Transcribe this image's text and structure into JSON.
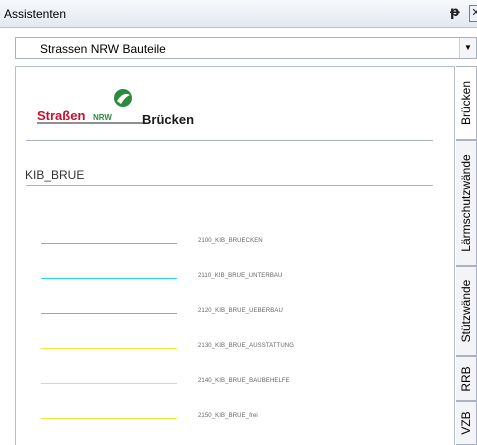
{
  "window": {
    "title": "Assistenten",
    "pin_icon": "pin-icon",
    "close_icon": "close-icon"
  },
  "dropdown": {
    "value": "Strassen NRW Bauteile",
    "arrow_icon": "chevron-down-icon"
  },
  "content": {
    "logo": {
      "text_main": "Straßen",
      "text_suffix": "NRW",
      "icon": "strassen-nrw-logo"
    },
    "section_title": "Brücken",
    "subheading": "KIB_BRUE",
    "layers": [
      {
        "label": "2100_KIB_BRUECKEN",
        "color": "#26d7e6"
      },
      {
        "label": "2110_KIB_BRUE_UNTERBAU",
        "color": "#26d7e6"
      },
      {
        "label": "2120_KIB_BRUE_UEBERBAU",
        "color": "#26d7e6"
      },
      {
        "label": "2130_KIB_BRUE_AUSSTATTUNG",
        "color": "#f2e43a"
      },
      {
        "label": "2140_KIB_BRUE_BAUBEHELFE",
        "color": "#f2e43a"
      },
      {
        "label": "2150_KIB_BRUE_frei",
        "color": "#f2e43a"
      }
    ]
  },
  "tabs": [
    {
      "label": "Brücken",
      "active": true
    },
    {
      "label": "Lärmschutzwände",
      "active": false
    },
    {
      "label": "Stützwände",
      "active": false
    },
    {
      "label": "RRB",
      "active": false
    },
    {
      "label": "VZB",
      "active": false
    }
  ],
  "colors": {
    "logo_red": "#c8102e",
    "logo_green": "#2e8b3e",
    "cyan": "#26d7e6",
    "yellow": "#f2e43a"
  }
}
